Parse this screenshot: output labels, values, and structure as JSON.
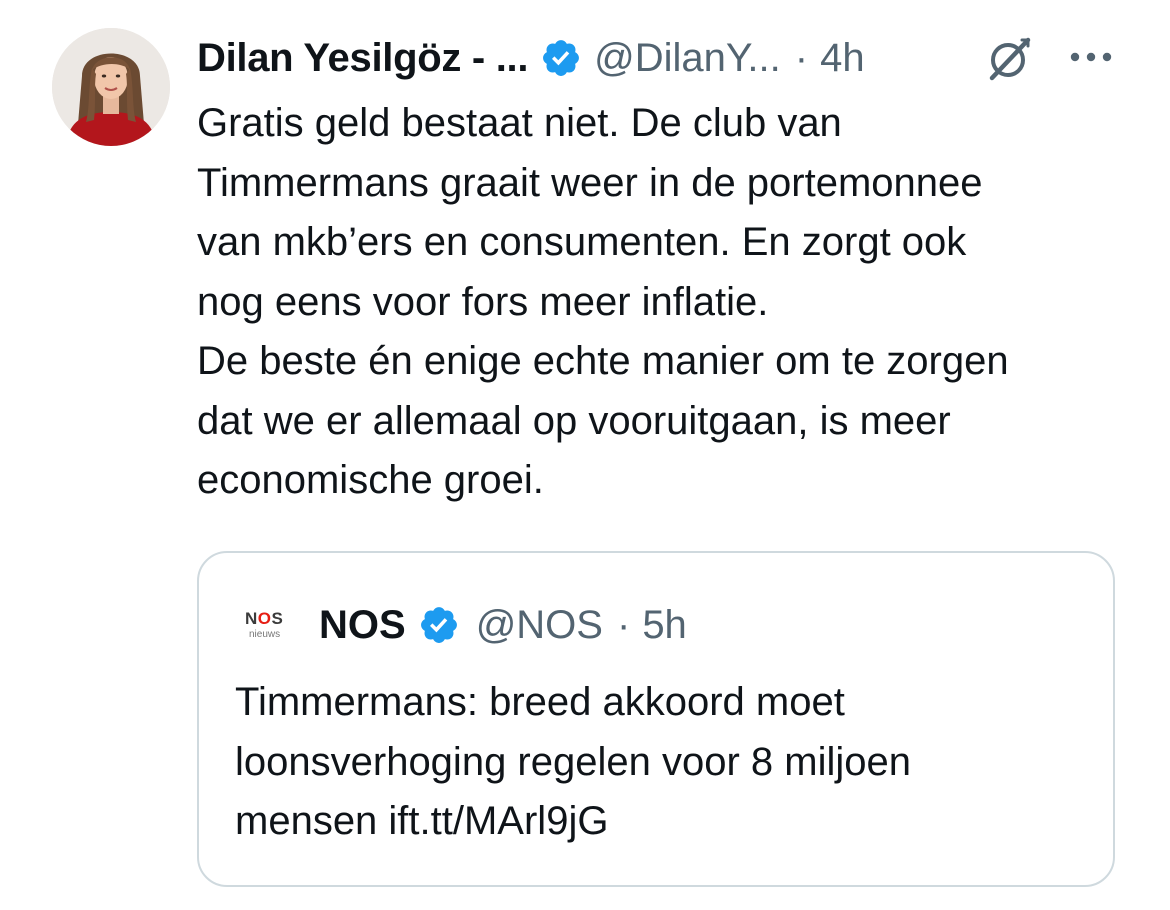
{
  "tweet": {
    "author": {
      "display_name": "Dilan Yesilgöz - ...",
      "handle": "@DilanY...",
      "verified": true
    },
    "separator": "·",
    "timestamp": "4h",
    "icons": {
      "verified": "verified-badge-icon",
      "grok": "grok-icon",
      "more": "more-options-icon"
    },
    "text_lines": [
      "Gratis geld bestaat niet. De club van",
      "Timmermans graait weer in de portemonnee",
      "van mkb’ers en consumenten. En zorgt ook",
      "nog eens voor fors meer inflatie.",
      "De beste én enige echte manier om te zorgen",
      "dat we er allemaal op vooruitgaan, is meer",
      "economische groei."
    ]
  },
  "quoted_tweet": {
    "logo": {
      "mark_letters": [
        "N",
        "O",
        "S"
      ],
      "subtitle": "nieuws"
    },
    "display_name": "NOS",
    "handle": "@NOS",
    "separator": "·",
    "timestamp": "5h",
    "verified": true,
    "text_lines": [
      "Timmermans: breed akkoord moet",
      "loonsverhoging regelen voor 8 miljoen",
      "mensen ift.tt/MArl9jG"
    ]
  },
  "colors": {
    "text_primary": "#0f1419",
    "text_secondary": "#536471",
    "verified_blue": "#1d9bf0",
    "card_border": "#cfd9de",
    "nos_red": "#e61e14"
  }
}
